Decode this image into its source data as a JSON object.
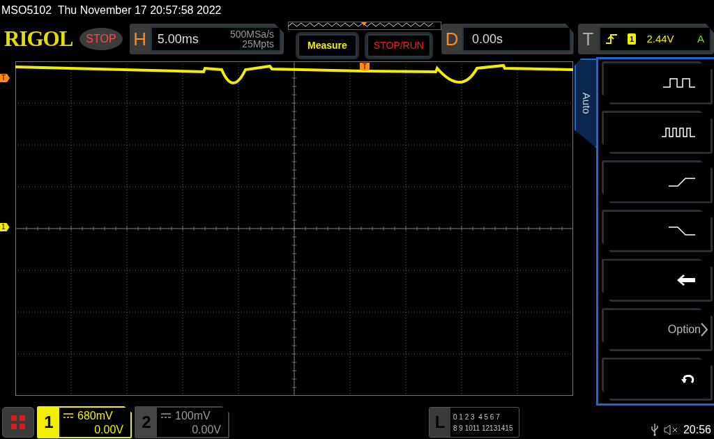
{
  "title_bar": {
    "text": "MSO5102  Thu November 17 20:57:58 2022"
  },
  "header": {
    "logo": "RIGOL",
    "run_state": "STOP",
    "horizontal": {
      "label": "H",
      "timebase": "5.00ms",
      "sample_rate": "500MSa/s",
      "memory_depth": "25Mpts"
    },
    "measure_button": "Measure",
    "stop_run_button": "STOP/RUN",
    "delay": {
      "label": "D",
      "value": "0.00s"
    },
    "trigger": {
      "label": "T",
      "channel": "1",
      "level": "2.44V",
      "mode": "A"
    }
  },
  "plot": {
    "trigger_level_marker": "T",
    "trigger_position_marker": "T",
    "channel_marker": "1"
  },
  "side_menu": {
    "tab": "Auto",
    "buttons": [
      {
        "kind": "pulse"
      },
      {
        "kind": "multi_pulse"
      },
      {
        "kind": "rise"
      },
      {
        "kind": "fall"
      },
      {
        "kind": "back_arrow"
      },
      {
        "kind": "option",
        "label": "Option"
      },
      {
        "kind": "undo"
      }
    ]
  },
  "channels": [
    {
      "number": "1",
      "active": true,
      "scale": "680mV",
      "offset": "0.00V"
    },
    {
      "number": "2",
      "active": false,
      "scale": "100mV",
      "offset": "0.00V"
    }
  ],
  "logic": {
    "label": "L",
    "row_1": "0 1 2 3  4 5 6 7",
    "row_2": "8 9 1011 12131415"
  },
  "status_bar": {
    "time": "20:56"
  }
}
